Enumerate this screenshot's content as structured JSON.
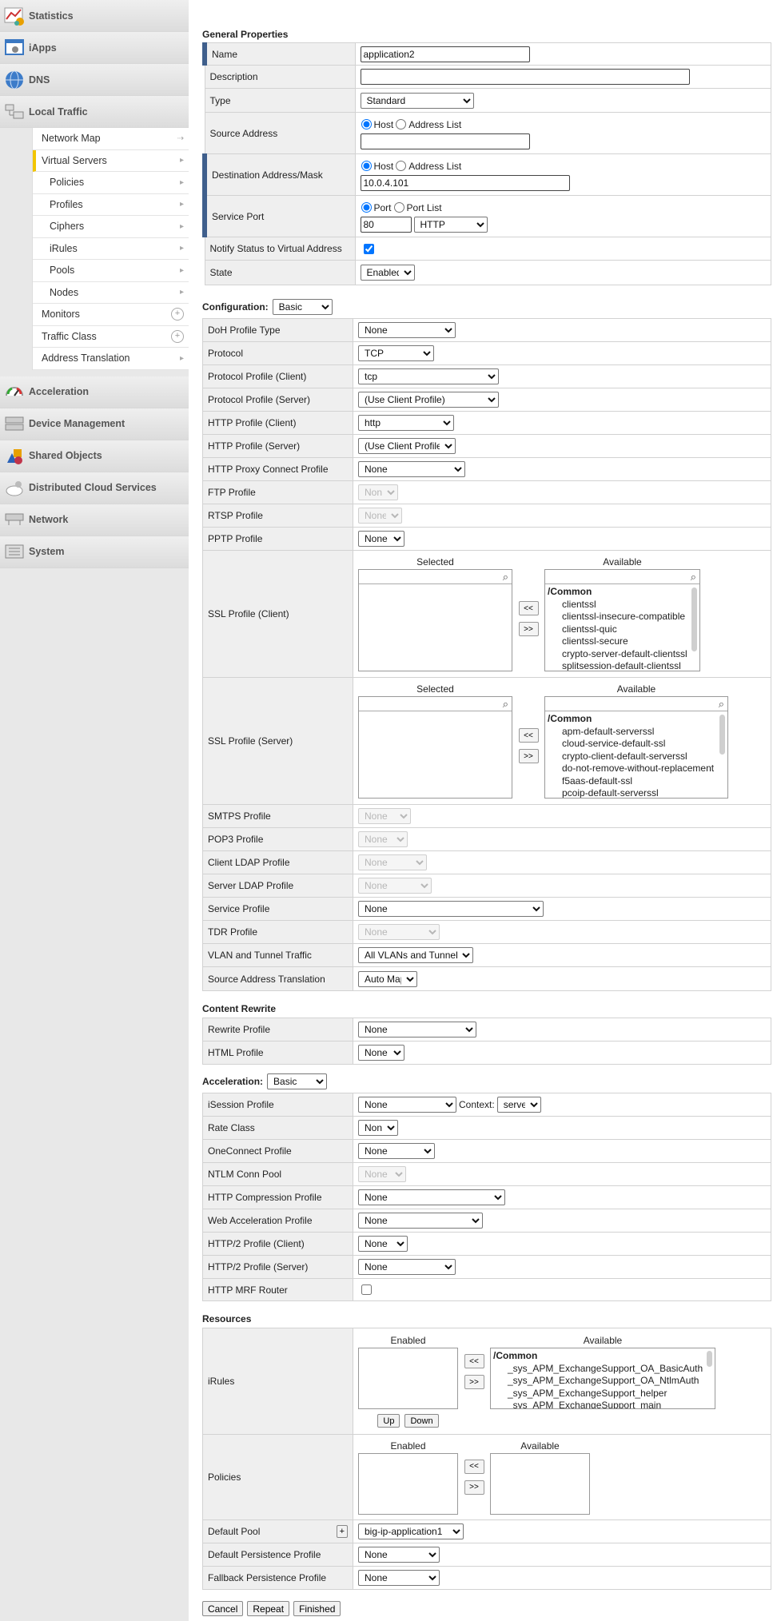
{
  "nav": {
    "top": [
      "Statistics",
      "iApps",
      "DNS",
      "Local Traffic"
    ],
    "sub": [
      "Network Map",
      "Virtual Servers",
      "Policies",
      "Profiles",
      "Ciphers",
      "iRules",
      "Pools",
      "Nodes",
      "Monitors",
      "Traffic Class",
      "Address Translation"
    ],
    "bottom": [
      "Acceleration",
      "Device Management",
      "Shared Objects",
      "Distributed Cloud Services",
      "Network",
      "System"
    ]
  },
  "general": {
    "heading": "General Properties",
    "name_lbl": "Name",
    "name_val": "application2",
    "desc_lbl": "Description",
    "desc_val": "",
    "type_lbl": "Type",
    "type_val": "Standard",
    "src_lbl": "Source Address",
    "host": "Host",
    "addr_list": "Address List",
    "dest_lbl": "Destination Address/Mask",
    "dest_val": "10.0.4.101",
    "port_lbl": "Service Port",
    "port": "Port",
    "port_list": "Port List",
    "port_val": "80",
    "port_proto": "HTTP",
    "notify_lbl": "Notify Status to Virtual Address",
    "state_lbl": "State",
    "state_val": "Enabled"
  },
  "config": {
    "heading": "Configuration:",
    "mode": "Basic",
    "rows": [
      {
        "label": "DoH Profile Type",
        "value": "None"
      },
      {
        "label": "Protocol",
        "value": "TCP"
      },
      {
        "label": "Protocol Profile (Client)",
        "value": "tcp"
      },
      {
        "label": "Protocol Profile (Server)",
        "value": "(Use Client Profile)"
      },
      {
        "label": "HTTP Profile (Client)",
        "value": "http"
      },
      {
        "label": "HTTP Profile (Server)",
        "value": "(Use Client Profile)"
      },
      {
        "label": "HTTP Proxy Connect Profile",
        "value": "None"
      },
      {
        "label": "FTP Profile",
        "value": "None"
      },
      {
        "label": "RTSP Profile",
        "value": "None"
      },
      {
        "label": "PPTP Profile",
        "value": "None"
      }
    ],
    "ssl_client_lbl": "SSL Profile (Client)",
    "ssl_server_lbl": "SSL Profile (Server)",
    "selected": "Selected",
    "available": "Available",
    "move_left": "<<",
    "move_right": ">>",
    "ssl_client_group": "/Common",
    "ssl_client_items": [
      "clientssl",
      "clientssl-insecure-compatible",
      "clientssl-quic",
      "clientssl-secure",
      "crypto-server-default-clientssl",
      "splitsession-default-clientssl"
    ],
    "ssl_server_group": "/Common",
    "ssl_server_items": [
      "apm-default-serverssl",
      "cloud-service-default-ssl",
      "crypto-client-default-serverssl",
      "do-not-remove-without-replacement",
      "f5aas-default-ssl",
      "pcoip-default-serverssl"
    ],
    "rows2": [
      {
        "label": "SMTPS Profile",
        "value": "None"
      },
      {
        "label": "POP3 Profile",
        "value": "None"
      },
      {
        "label": "Client LDAP Profile",
        "value": "None"
      },
      {
        "label": "Server LDAP Profile",
        "value": "None"
      },
      {
        "label": "Service Profile",
        "value": "None"
      },
      {
        "label": "TDR Profile",
        "value": "None"
      },
      {
        "label": "VLAN and Tunnel Traffic",
        "value": "All VLANs and Tunnels"
      },
      {
        "label": "Source Address Translation",
        "value": "Auto Map"
      }
    ]
  },
  "rewrite": {
    "heading": "Content Rewrite",
    "rows": [
      {
        "label": "Rewrite Profile",
        "value": "None"
      },
      {
        "label": "HTML Profile",
        "value": "None"
      }
    ]
  },
  "accel": {
    "heading": "Acceleration:",
    "mode": "Basic",
    "context_lbl": "Context:",
    "context_val": "server",
    "rows": [
      {
        "label": "iSession Profile",
        "value": "None"
      },
      {
        "label": "Rate Class",
        "value": "None"
      },
      {
        "label": "OneConnect Profile",
        "value": "None"
      },
      {
        "label": "NTLM Conn Pool",
        "value": "None"
      },
      {
        "label": "HTTP Compression Profile",
        "value": "None"
      },
      {
        "label": "Web Acceleration Profile",
        "value": "None"
      },
      {
        "label": "HTTP/2 Profile (Client)",
        "value": "None"
      },
      {
        "label": "HTTP/2 Profile (Server)",
        "value": "None"
      },
      {
        "label": "HTTP MRF Router",
        "value": ""
      }
    ]
  },
  "resources": {
    "heading": "Resources",
    "irules_lbl": "iRules",
    "policies_lbl": "Policies",
    "enabled": "Enabled",
    "available": "Available",
    "up": "Up",
    "down": "Down",
    "irules_group": "/Common",
    "irules_items": [
      "_sys_APM_ExchangeSupport_OA_BasicAuth",
      "_sys_APM_ExchangeSupport_OA_NtlmAuth",
      "_sys_APM_ExchangeSupport_helper",
      "_sys_APM_ExchangeSupport_main"
    ],
    "pool_lbl": "Default Pool",
    "pool_plus": "+",
    "pool_val": "big-ip-application1",
    "persist_lbl": "Default Persistence Profile",
    "persist_val": "None",
    "fallback_lbl": "Fallback Persistence Profile",
    "fallback_val": "None"
  },
  "actions": {
    "cancel": "Cancel",
    "repeat": "Repeat",
    "finished": "Finished"
  }
}
